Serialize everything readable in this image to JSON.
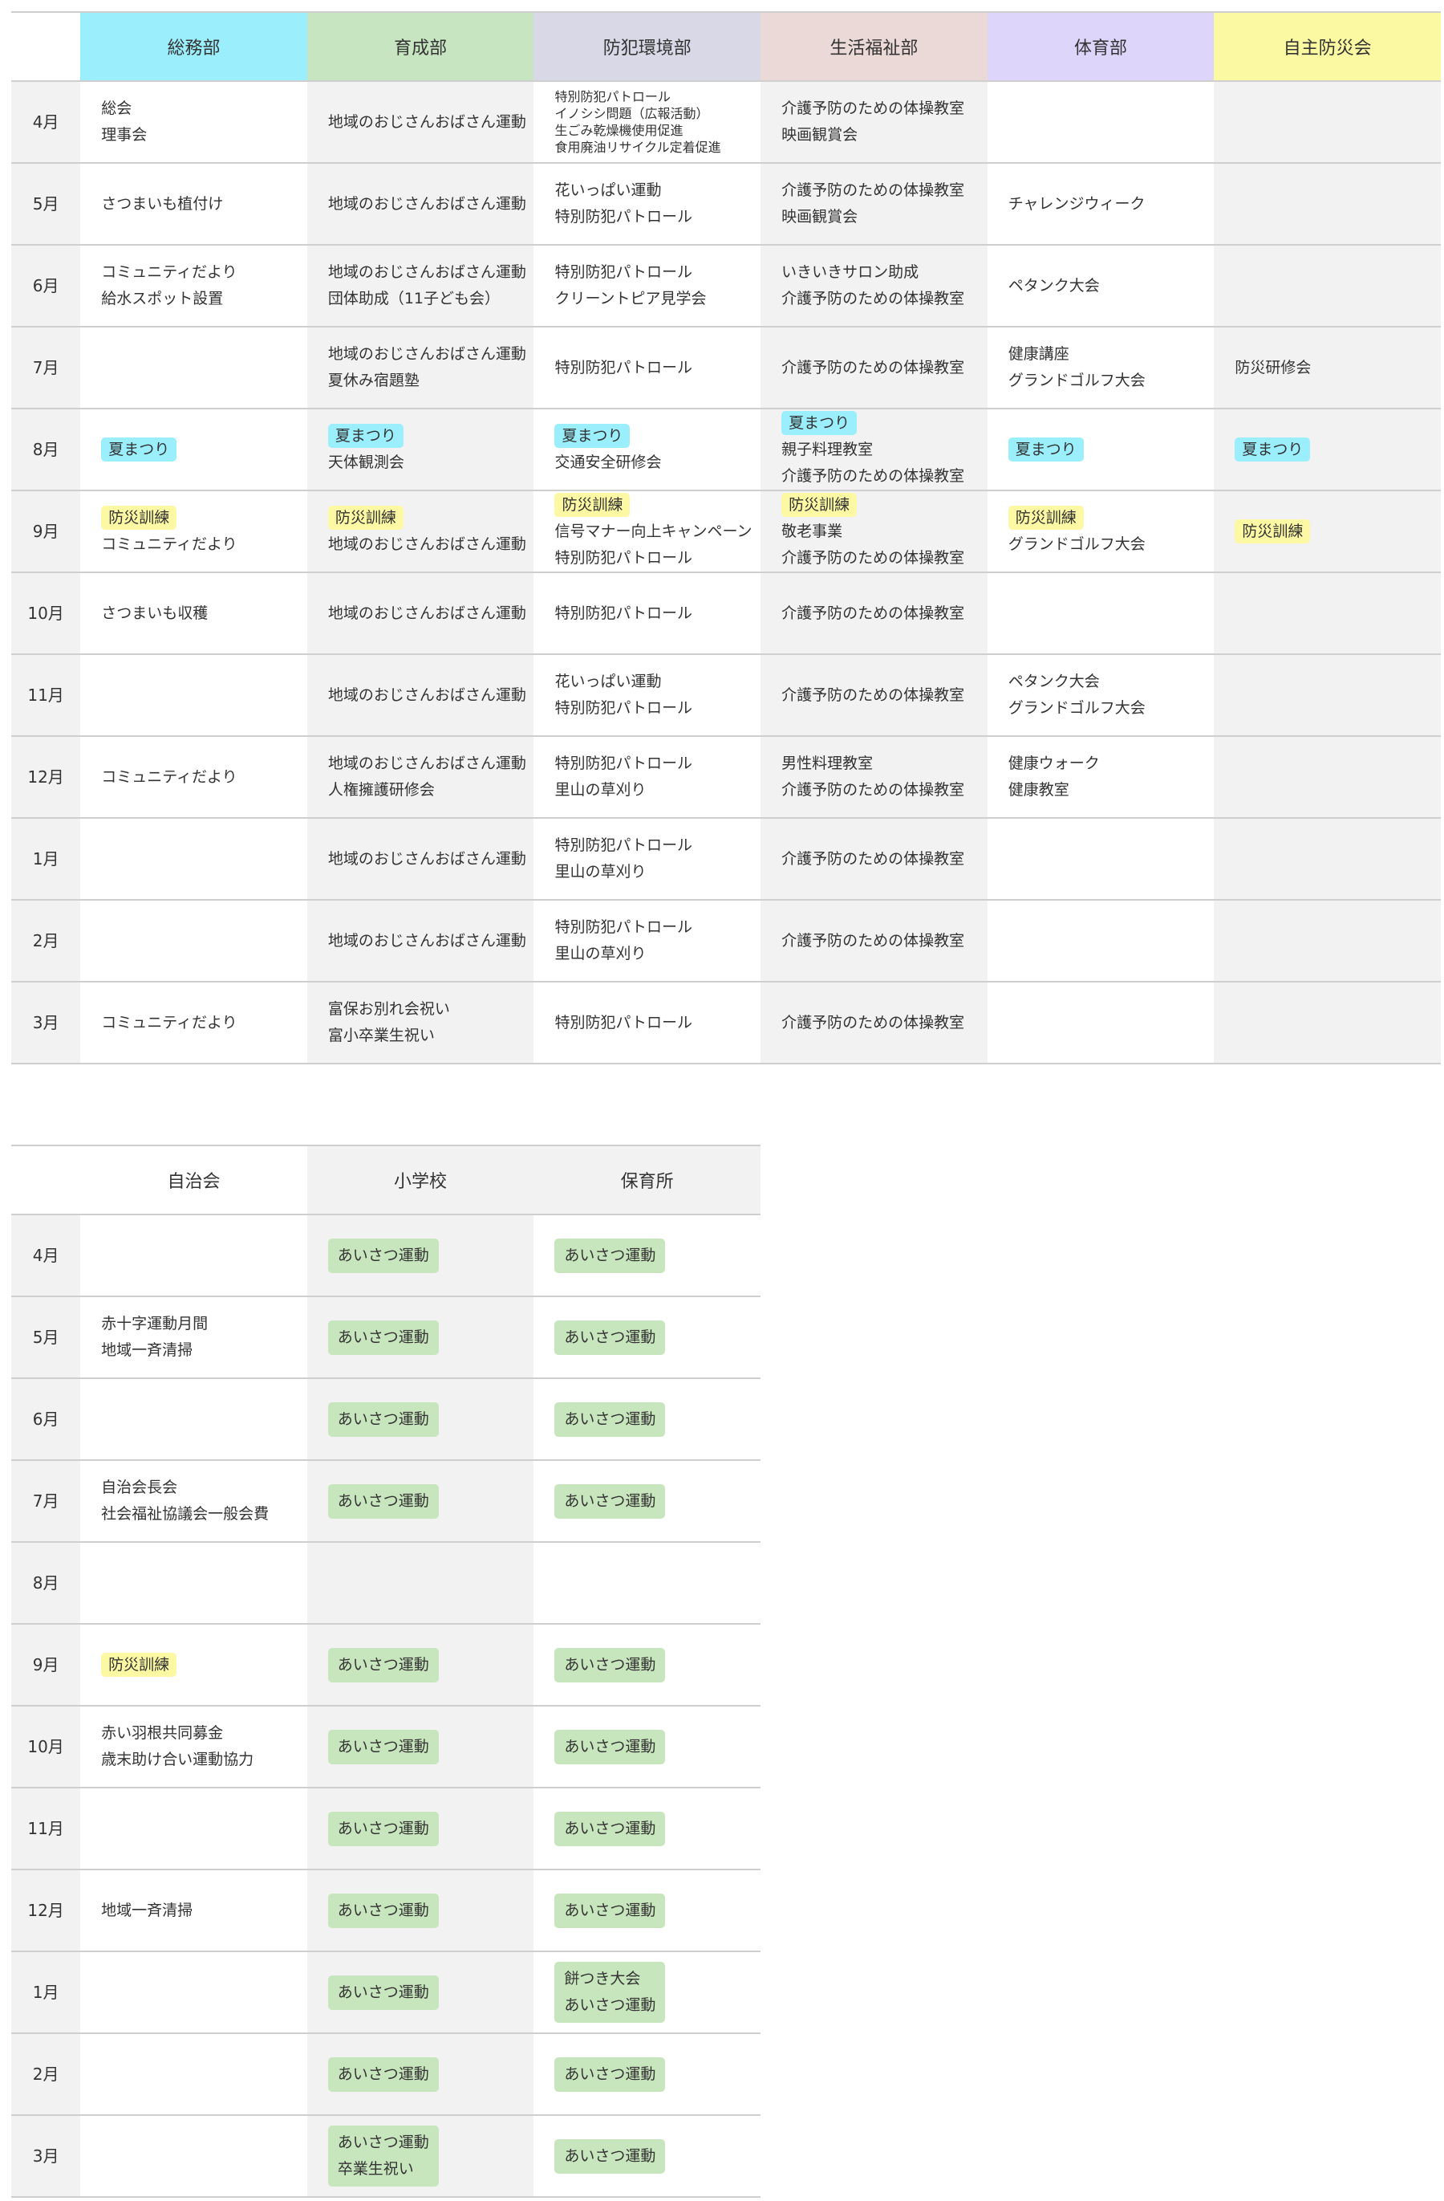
{
  "colors": {
    "somubu": "#9beefb",
    "ikuseibu": "#c7e5c1",
    "bohan": "#d9d8e6",
    "seikatsu": "#ead9d6",
    "taiiku": "#ddd6fa",
    "jishubosai": "#fbf9a2",
    "tag_natsumatsuri": "#9beefb",
    "tag_bosai": "#fcf8a4",
    "tag_aisatsu": "#c8e6bd"
  },
  "table1": {
    "headers": [
      "総務部",
      "育成部",
      "防犯環境部",
      "生活福祉部",
      "体育部",
      "自主防災会"
    ],
    "months": [
      "4月",
      "5月",
      "6月",
      "7月",
      "8月",
      "9月",
      "10月",
      "11月",
      "12月",
      "1月",
      "2月",
      "3月"
    ],
    "rows": [
      {
        "somubu": [
          "総会",
          "理事会"
        ],
        "ikuseibu": [
          "地域のおじさんおばさん運動"
        ],
        "bohan": [
          "特別防犯パトロール",
          "イノシシ問題（広報活動）",
          "生ごみ乾燥機使用促進",
          "食用廃油リサイクル定着促進"
        ],
        "seikatsu": [
          "介護予防のための体操教室",
          "映画観賞会"
        ],
        "taiiku": [],
        "jishubosai": []
      },
      {
        "somubu": [
          "さつまいも植付け"
        ],
        "ikuseibu": [
          "地域のおじさんおばさん運動"
        ],
        "bohan": [
          "花いっぱい運動",
          "特別防犯パトロール"
        ],
        "seikatsu": [
          "介護予防のための体操教室",
          "映画観賞会"
        ],
        "taiiku": [
          "チャレンジウィーク"
        ],
        "jishubosai": []
      },
      {
        "somubu": [
          "コミュニティだより",
          "給水スポット設置"
        ],
        "ikuseibu": [
          "地域のおじさんおばさん運動",
          "団体助成（11子ども会）"
        ],
        "bohan": [
          "特別防犯パトロール",
          "クリーントピア見学会"
        ],
        "seikatsu": [
          "いきいきサロン助成",
          "介護予防のための体操教室"
        ],
        "taiiku": [
          "ペタンク大会"
        ],
        "jishubosai": []
      },
      {
        "somubu": [],
        "ikuseibu": [
          "地域のおじさんおばさん運動",
          "夏休み宿題塾"
        ],
        "bohan": [
          "特別防犯パトロール"
        ],
        "seikatsu": [
          "介護予防のための体操教室"
        ],
        "taiiku": [
          "健康講座",
          "グランドゴルフ大会"
        ],
        "jishubosai": [
          "防災研修会"
        ]
      },
      {
        "somubu": [
          "夏まつり"
        ],
        "ikuseibu": [
          "夏まつり",
          "天体観測会"
        ],
        "bohan": [
          "夏まつり",
          "交通安全研修会"
        ],
        "seikatsu": [
          "夏まつり",
          "親子料理教室",
          "介護予防のための体操教室"
        ],
        "taiiku": [
          "夏まつり"
        ],
        "jishubosai": [
          "夏まつり"
        ]
      },
      {
        "somubu": [
          "防災訓練",
          "コミュニティだより"
        ],
        "ikuseibu": [
          "防災訓練",
          "地域のおじさんおばさん運動"
        ],
        "bohan": [
          "防災訓練",
          "信号マナー向上キャンペーン",
          "特別防犯パトロール"
        ],
        "seikatsu": [
          "防災訓練",
          "敬老事業",
          "介護予防のための体操教室"
        ],
        "taiiku": [
          "防災訓練",
          "グランドゴルフ大会"
        ],
        "jishubosai": [
          "防災訓練"
        ]
      },
      {
        "somubu": [
          "さつまいも収穫"
        ],
        "ikuseibu": [
          "地域のおじさんおばさん運動"
        ],
        "bohan": [
          "特別防犯パトロール"
        ],
        "seikatsu": [
          "介護予防のための体操教室"
        ],
        "taiiku": [],
        "jishubosai": []
      },
      {
        "somubu": [],
        "ikuseibu": [
          "地域のおじさんおばさん運動"
        ],
        "bohan": [
          "花いっぱい運動",
          "特別防犯パトロール"
        ],
        "seikatsu": [
          "介護予防のための体操教室"
        ],
        "taiiku": [
          "ペタンク大会",
          "グランドゴルフ大会"
        ],
        "jishubosai": []
      },
      {
        "somubu": [
          "コミュニティだより"
        ],
        "ikuseibu": [
          "地域のおじさんおばさん運動",
          "人権擁護研修会"
        ],
        "bohan": [
          "特別防犯パトロール",
          "里山の草刈り"
        ],
        "seikatsu": [
          "男性料理教室",
          "介護予防のための体操教室"
        ],
        "taiiku": [
          "健康ウォーク",
          "健康教室"
        ],
        "jishubosai": []
      },
      {
        "somubu": [],
        "ikuseibu": [
          "地域のおじさんおばさん運動"
        ],
        "bohan": [
          "特別防犯パトロール",
          "里山の草刈り"
        ],
        "seikatsu": [
          "介護予防のための体操教室"
        ],
        "taiiku": [],
        "jishubosai": []
      },
      {
        "somubu": [],
        "ikuseibu": [
          "地域のおじさんおばさん運動"
        ],
        "bohan": [
          "特別防犯パトロール",
          "里山の草刈り"
        ],
        "seikatsu": [
          "介護予防のための体操教室"
        ],
        "taiiku": [],
        "jishubosai": []
      },
      {
        "somubu": [
          "コミュニティだより"
        ],
        "ikuseibu": [
          "富保お別れ会祝い",
          "富小卒業生祝い"
        ],
        "bohan": [
          "特別防犯パトロール"
        ],
        "seikatsu": [
          "介護予防のための体操教室"
        ],
        "taiiku": [],
        "jishubosai": []
      }
    ]
  },
  "table2": {
    "headers": [
      "自治会",
      "小学校",
      "保育所"
    ],
    "months": [
      "4月",
      "5月",
      "6月",
      "7月",
      "8月",
      "9月",
      "10月",
      "11月",
      "12月",
      "1月",
      "2月",
      "3月"
    ],
    "rows": [
      {
        "jichikai": [],
        "shogakko": [
          "あいさつ運動"
        ],
        "hoikusho": [
          "あいさつ運動"
        ]
      },
      {
        "jichikai": [
          "赤十字運動月間",
          "地域一斉清掃"
        ],
        "shogakko": [
          "あいさつ運動"
        ],
        "hoikusho": [
          "あいさつ運動"
        ]
      },
      {
        "jichikai": [],
        "shogakko": [
          "あいさつ運動"
        ],
        "hoikusho": [
          "あいさつ運動"
        ]
      },
      {
        "jichikai": [
          "自治会長会",
          "社会福祉協議会一般会費"
        ],
        "shogakko": [
          "あいさつ運動"
        ],
        "hoikusho": [
          "あいさつ運動"
        ]
      },
      {
        "jichikai": [],
        "shogakko": [],
        "hoikusho": []
      },
      {
        "jichikai": [
          "防災訓練"
        ],
        "shogakko": [
          "あいさつ運動"
        ],
        "hoikusho": [
          "あいさつ運動"
        ]
      },
      {
        "jichikai": [
          "赤い羽根共同募金",
          "歳末助け合い運動協力"
        ],
        "shogakko": [
          "あいさつ運動"
        ],
        "hoikusho": [
          "あいさつ運動"
        ]
      },
      {
        "jichikai": [],
        "shogakko": [
          "あいさつ運動"
        ],
        "hoikusho": [
          "あいさつ運動"
        ]
      },
      {
        "jichikai": [
          "地域一斉清掃"
        ],
        "shogakko": [
          "あいさつ運動"
        ],
        "hoikusho": [
          "あいさつ運動"
        ]
      },
      {
        "jichikai": [],
        "shogakko": [
          "あいさつ運動"
        ],
        "hoikusho": [
          "餅つき大会",
          "あいさつ運動"
        ]
      },
      {
        "jichikai": [],
        "shogakko": [
          "あいさつ運動"
        ],
        "hoikusho": [
          "あいさつ運動"
        ]
      },
      {
        "jichikai": [],
        "shogakko": [
          "あいさつ運動",
          "卒業生祝い"
        ],
        "hoikusho": [
          "あいさつ運動"
        ]
      }
    ]
  }
}
